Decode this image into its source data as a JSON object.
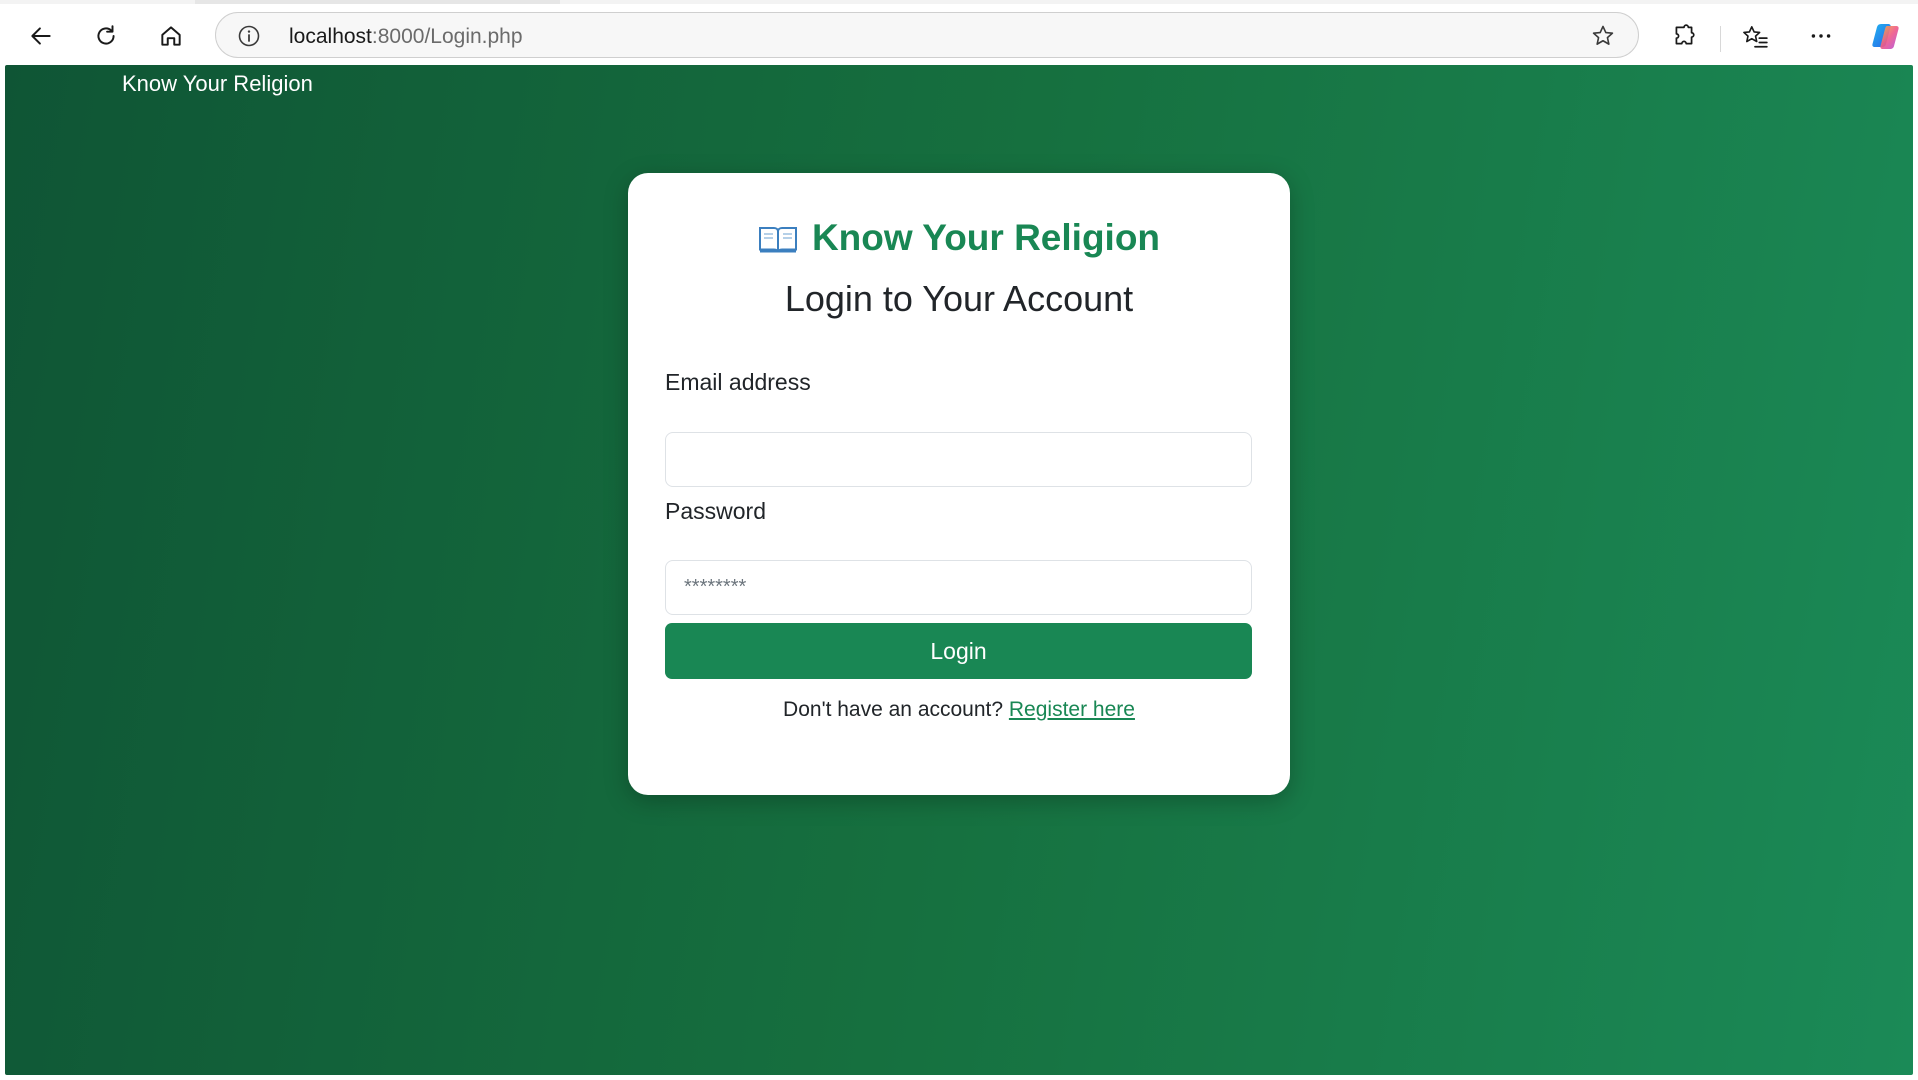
{
  "browser": {
    "url_host": "localhost",
    "url_path": ":8000/Login.php",
    "icons": {
      "back": "back-arrow-icon",
      "reload": "reload-icon",
      "home": "home-icon",
      "info": "info-icon",
      "favorite": "star-icon",
      "extensions": "puzzle-icon",
      "favorites": "favorites-icon",
      "menu": "more-icon",
      "copilot": "copilot-icon"
    }
  },
  "navbar": {
    "brand": "Know Your Religion"
  },
  "login_card": {
    "brand": "Know Your Religion",
    "brand_icon": "book-icon",
    "title": "Login to Your Account",
    "email_label": "Email address",
    "email_value": "",
    "password_label": "Password",
    "password_placeholder": "********",
    "submit_label": "Login",
    "register_prompt": "Don't have an account?",
    "register_link": "Register here"
  },
  "colors": {
    "accent": "#198754",
    "gradient_start": "#0f5535",
    "gradient_end": "#1b8a57"
  }
}
